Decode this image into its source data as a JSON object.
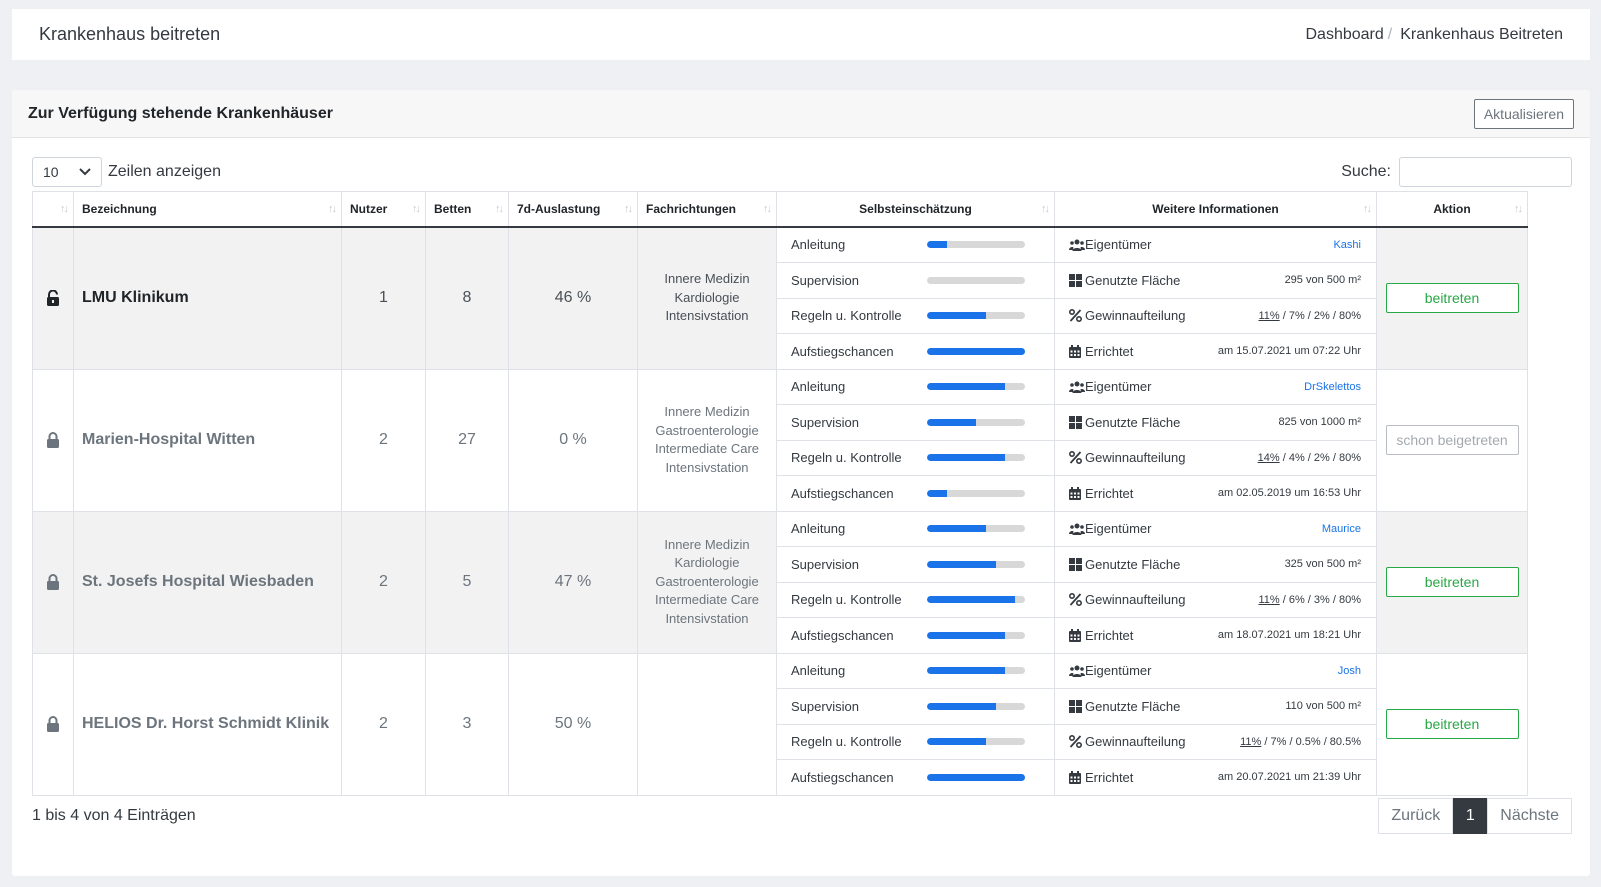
{
  "topbar": {
    "title": "Krankenhaus beitreten",
    "breadcrumb": [
      "Dashboard",
      "Krankenhaus Beitreten"
    ],
    "separator": "/"
  },
  "card": {
    "title": "Zur Verfügung stehende Krankenhäuser",
    "refresh_label": "Aktualisieren"
  },
  "controls": {
    "length_value": "10",
    "length_label": "Zeilen anzeigen",
    "search_label": "Suche:",
    "search_value": ""
  },
  "columns": [
    "",
    "Bezeichnung",
    "Nutzer",
    "Betten",
    "7d-Auslastung",
    "Fachrichtungen",
    "Selbsteinschätzung",
    "Weitere Informationen",
    "Aktion"
  ],
  "skill_labels": [
    "Anleitung",
    "Supervision",
    "Regeln u. Kontrolle",
    "Aufstiegschancen"
  ],
  "info_labels": [
    "Eigentümer",
    "Genutzte Fläche",
    "Gewinnaufteilung",
    "Errichtet"
  ],
  "rows": [
    {
      "name": "LMU Klinikum",
      "locked": false,
      "nutzer": "1",
      "betten": "8",
      "auslastung": "46 %",
      "fachrichtungen": [
        "Innere Medizin",
        "Kardiologie",
        "Intensivstation"
      ],
      "skills": [
        0.2,
        0.0,
        0.6,
        1.0
      ],
      "owner": "Kashi",
      "flaeche": "295 von 500 m²",
      "gewinn_first": "11%",
      "gewinn_rest": " / 7% / 2% / 80%",
      "errichtet": "am 15.07.2021 um 07:22 Uhr",
      "action": "beitreten",
      "joined": false
    },
    {
      "name": "Marien-Hospital Witten",
      "locked": true,
      "nutzer": "2",
      "betten": "27",
      "auslastung": "0 %",
      "fachrichtungen": [
        "Innere Medizin",
        "Gastroenterologie",
        "Intermediate Care",
        "Intensivstation"
      ],
      "skills": [
        0.8,
        0.5,
        0.8,
        0.2
      ],
      "owner": "DrSkelettos",
      "flaeche": "825 von 1000 m²",
      "gewinn_first": "14%",
      "gewinn_rest": " / 4% / 2% / 80%",
      "errichtet": "am 02.05.2019 um 16:53 Uhr",
      "action": "schon beigetreten",
      "joined": true
    },
    {
      "name": "St. Josefs Hospital Wiesbaden",
      "locked": true,
      "nutzer": "2",
      "betten": "5",
      "auslastung": "47 %",
      "fachrichtungen": [
        "Innere Medizin",
        "Kardiologie",
        "Gastroenterologie",
        "Intermediate Care",
        "Intensivstation"
      ],
      "skills": [
        0.6,
        0.7,
        0.9,
        0.8
      ],
      "owner": "Maurice",
      "flaeche": "325 von 500 m²",
      "gewinn_first": "11%",
      "gewinn_rest": " / 6% / 3% / 80%",
      "errichtet": "am 18.07.2021 um 18:21 Uhr",
      "action": "beitreten",
      "joined": false
    },
    {
      "name": "HELIOS Dr. Horst Schmidt Klinik",
      "locked": true,
      "nutzer": "2",
      "betten": "3",
      "auslastung": "50 %",
      "fachrichtungen": [],
      "skills": [
        0.8,
        0.7,
        0.6,
        1.0
      ],
      "owner": "Josh",
      "flaeche": "110 von 500 m²",
      "gewinn_first": "11%",
      "gewinn_rest": " / 7% / 0.5% / 80.5%",
      "errichtet": "am 20.07.2021 um 21:39 Uhr",
      "action": "beitreten",
      "joined": false
    }
  ],
  "footer": {
    "info": "1 bis 4 von 4 Einträgen",
    "prev": "Zurück",
    "current": "1",
    "next": "Nächste"
  },
  "colors": {
    "accent": "#1a73e8",
    "success": "#28a745",
    "dark": "#343a40"
  }
}
